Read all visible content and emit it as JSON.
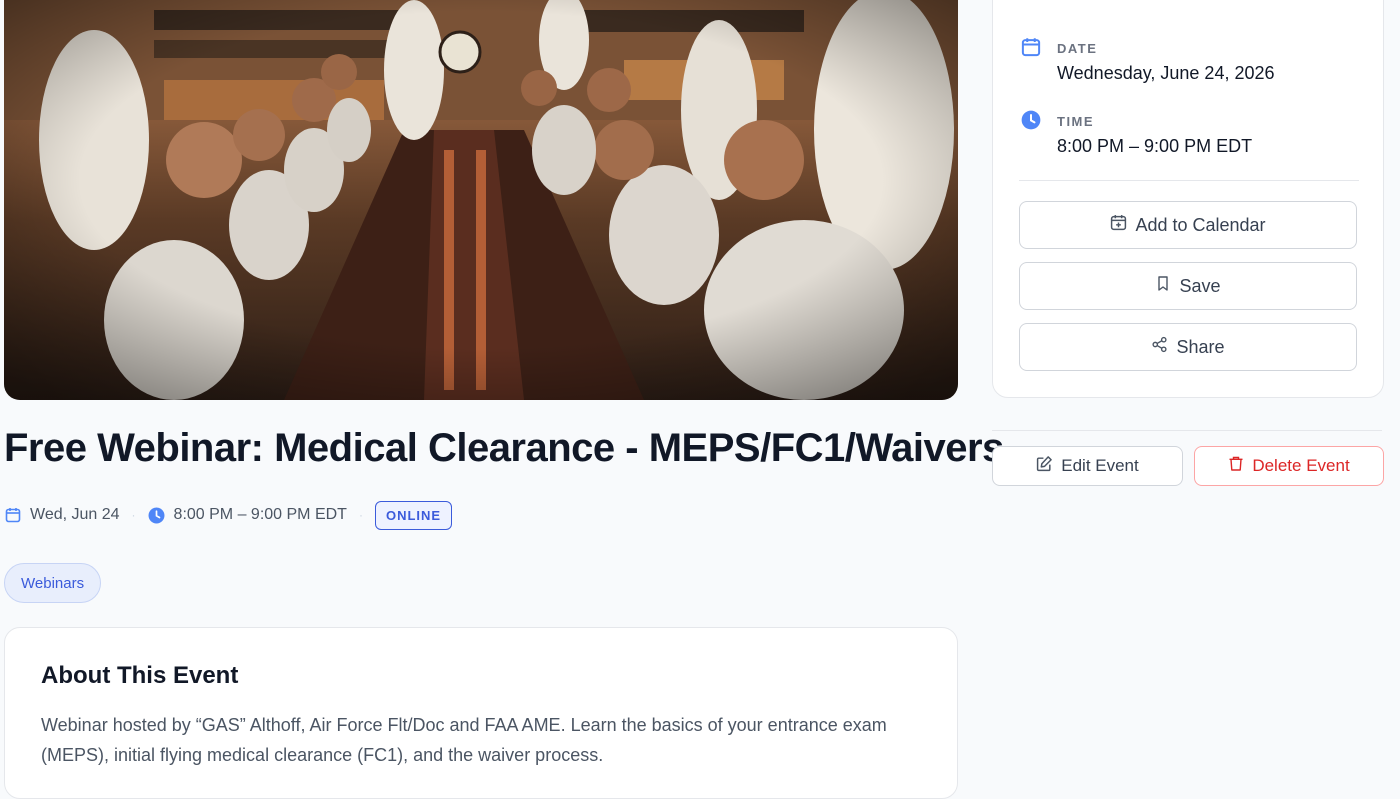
{
  "hero": {
    "alt": "Event banner photo"
  },
  "event": {
    "title": "Free Webinar: Medical Clearance - MEPS/FC1/Waivers",
    "date_short": "Wed, Jun 24",
    "time": "8:00 PM – 9:00 PM EDT",
    "format_badge": "ONLINE",
    "category_tag": "Webinars"
  },
  "about": {
    "heading": "About This Event",
    "body": "Webinar hosted by “GAS” Althoff, Air Force Flt/Doc and FAA AME. Learn the basics of your entrance exam (MEPS), initial flying medical clearance (FC1), and the waiver process."
  },
  "sidebar": {
    "date_label": "DATE",
    "date_value": "Wednesday, June 24, 2026",
    "time_label": "TIME",
    "time_value": "8:00 PM – 9:00 PM EDT",
    "add_to_calendar_label": "Add to Calendar",
    "save_label": "Save",
    "share_label": "Share"
  },
  "actions": {
    "edit_label": "Edit Event",
    "delete_label": "Delete Event"
  },
  "colors": {
    "accent": "#3b5bdb",
    "clock": "#4f86f7",
    "danger": "#dc2626"
  },
  "icons": [
    "calendar-icon",
    "clock-icon",
    "calendar-plus-icon",
    "bookmark-icon",
    "share-icon",
    "edit-icon",
    "trash-icon"
  ]
}
